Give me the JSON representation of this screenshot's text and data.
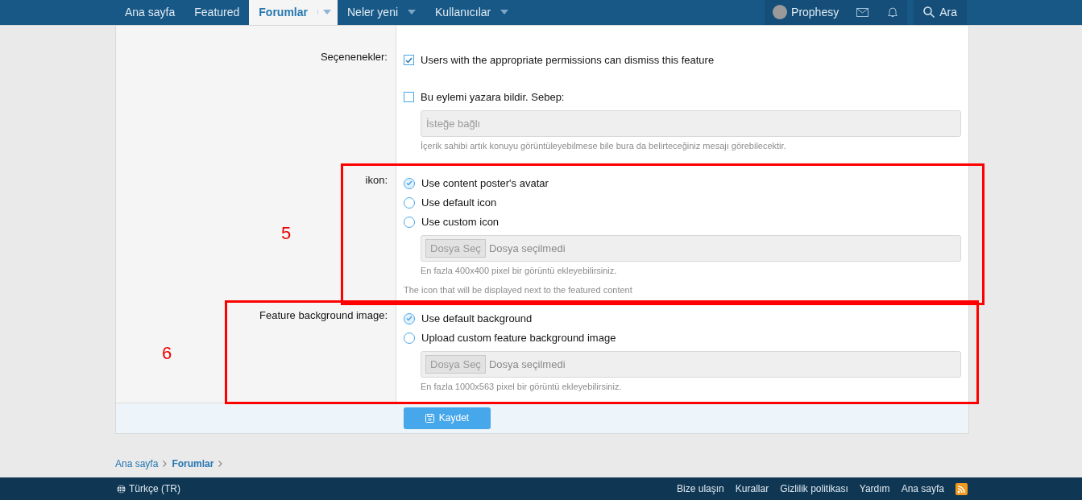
{
  "nav": {
    "items": [
      {
        "label": "Ana sayfa",
        "selected": false,
        "dropdown": false
      },
      {
        "label": "Featured",
        "selected": false,
        "dropdown": false
      },
      {
        "label": "Forumlar",
        "selected": true,
        "dropdown": true
      },
      {
        "label": "Neler yeni",
        "selected": false,
        "dropdown": true
      },
      {
        "label": "Kullanıcılar",
        "selected": false,
        "dropdown": true
      }
    ],
    "user": {
      "name": "Prophesy"
    },
    "search": {
      "label": "Ara"
    }
  },
  "form": {
    "rows": [
      {
        "label": "Seçenenekler:",
        "controls": [
          {
            "kind": "checkbox",
            "label": "Users with the appropriate permissions can dismiss this feature",
            "checked": true
          },
          {
            "kind": "checkbox",
            "label": "Bu eylemi yazara bildir. Sebep:",
            "checked": false
          },
          {
            "kind": "text",
            "placeholder": "İsteğe bağlı"
          },
          {
            "kind": "hint",
            "text": "İçerik sahibi artık konuyu görüntüleyebilmese bile bura da belirteceğiniz mesajı görebilecektir."
          }
        ]
      },
      {
        "label": "ikon:",
        "annotation": "5",
        "controls": [
          {
            "kind": "radio",
            "label": "Use content poster's avatar",
            "selected": true
          },
          {
            "kind": "radio",
            "label": "Use default icon",
            "selected": false
          },
          {
            "kind": "radio",
            "label": "Use custom icon",
            "selected": false
          },
          {
            "kind": "file",
            "button": "Dosya Seç",
            "value": "Dosya seçilmedi"
          },
          {
            "kind": "hint",
            "text": "En fazla 400x400 pixel bir görüntü ekleyebilirsiniz."
          }
        ],
        "explain": "The icon that will be displayed next to the featured content"
      },
      {
        "label": "Feature background image:",
        "annotation": "6",
        "controls": [
          {
            "kind": "radio",
            "label": "Use default background",
            "selected": true
          },
          {
            "kind": "radio",
            "label": "Upload custom feature background image",
            "selected": false
          },
          {
            "kind": "file",
            "button": "Dosya Seç",
            "value": "Dosya seçilmedi"
          },
          {
            "kind": "hint",
            "text": "En fazla 1000x563 pixel bir görüntü ekleyebilirsiniz."
          }
        ]
      }
    ],
    "submit": "Kaydet"
  },
  "breadcrumb": [
    "Ana sayfa",
    "Forumlar"
  ],
  "footer": {
    "language": "Türkçe (TR)",
    "links": [
      "Bize ulaşın",
      "Kurallar",
      "Gizlilik politikası",
      "Yardım",
      "Ana sayfa"
    ]
  }
}
